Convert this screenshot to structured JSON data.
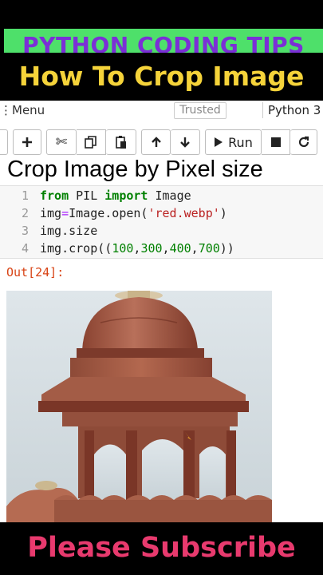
{
  "banner": {
    "channel_title": "PYTHON CODING TIPS",
    "video_title": "How To Crop Image",
    "subscribe": "Please Subscribe",
    "colors": {
      "green": "#4ee06a",
      "purple": "#7b2fd6",
      "yellow": "#f5d33a",
      "pink": "#e83a6e"
    }
  },
  "notebook": {
    "menu_label": "Menu",
    "trusted_label": "Trusted",
    "kernel_label": "Python 3",
    "toolbar": {
      "add_icon": "plus-icon",
      "cut_icon": "scissors-icon",
      "copy_icon": "copy-icon",
      "paste_icon": "paste-icon",
      "up_icon": "arrow-up-icon",
      "down_icon": "arrow-down-icon",
      "run_label": "Run",
      "stop_icon": "stop-icon",
      "restart_icon": "restart-icon"
    },
    "overlay_title": "Crop Image by Pixel size",
    "code_lines": [
      {
        "n": "1",
        "text": "from PIL import Image"
      },
      {
        "n": "2",
        "text": "img=Image.open('red.webp')"
      },
      {
        "n": "3",
        "text": "img.size"
      },
      {
        "n": "4",
        "text": "img.crop((100,300,400,700))"
      }
    ],
    "output_prompt": "Out[24]:",
    "output_image": "red-sandstone-dome-pavilion-photo"
  }
}
